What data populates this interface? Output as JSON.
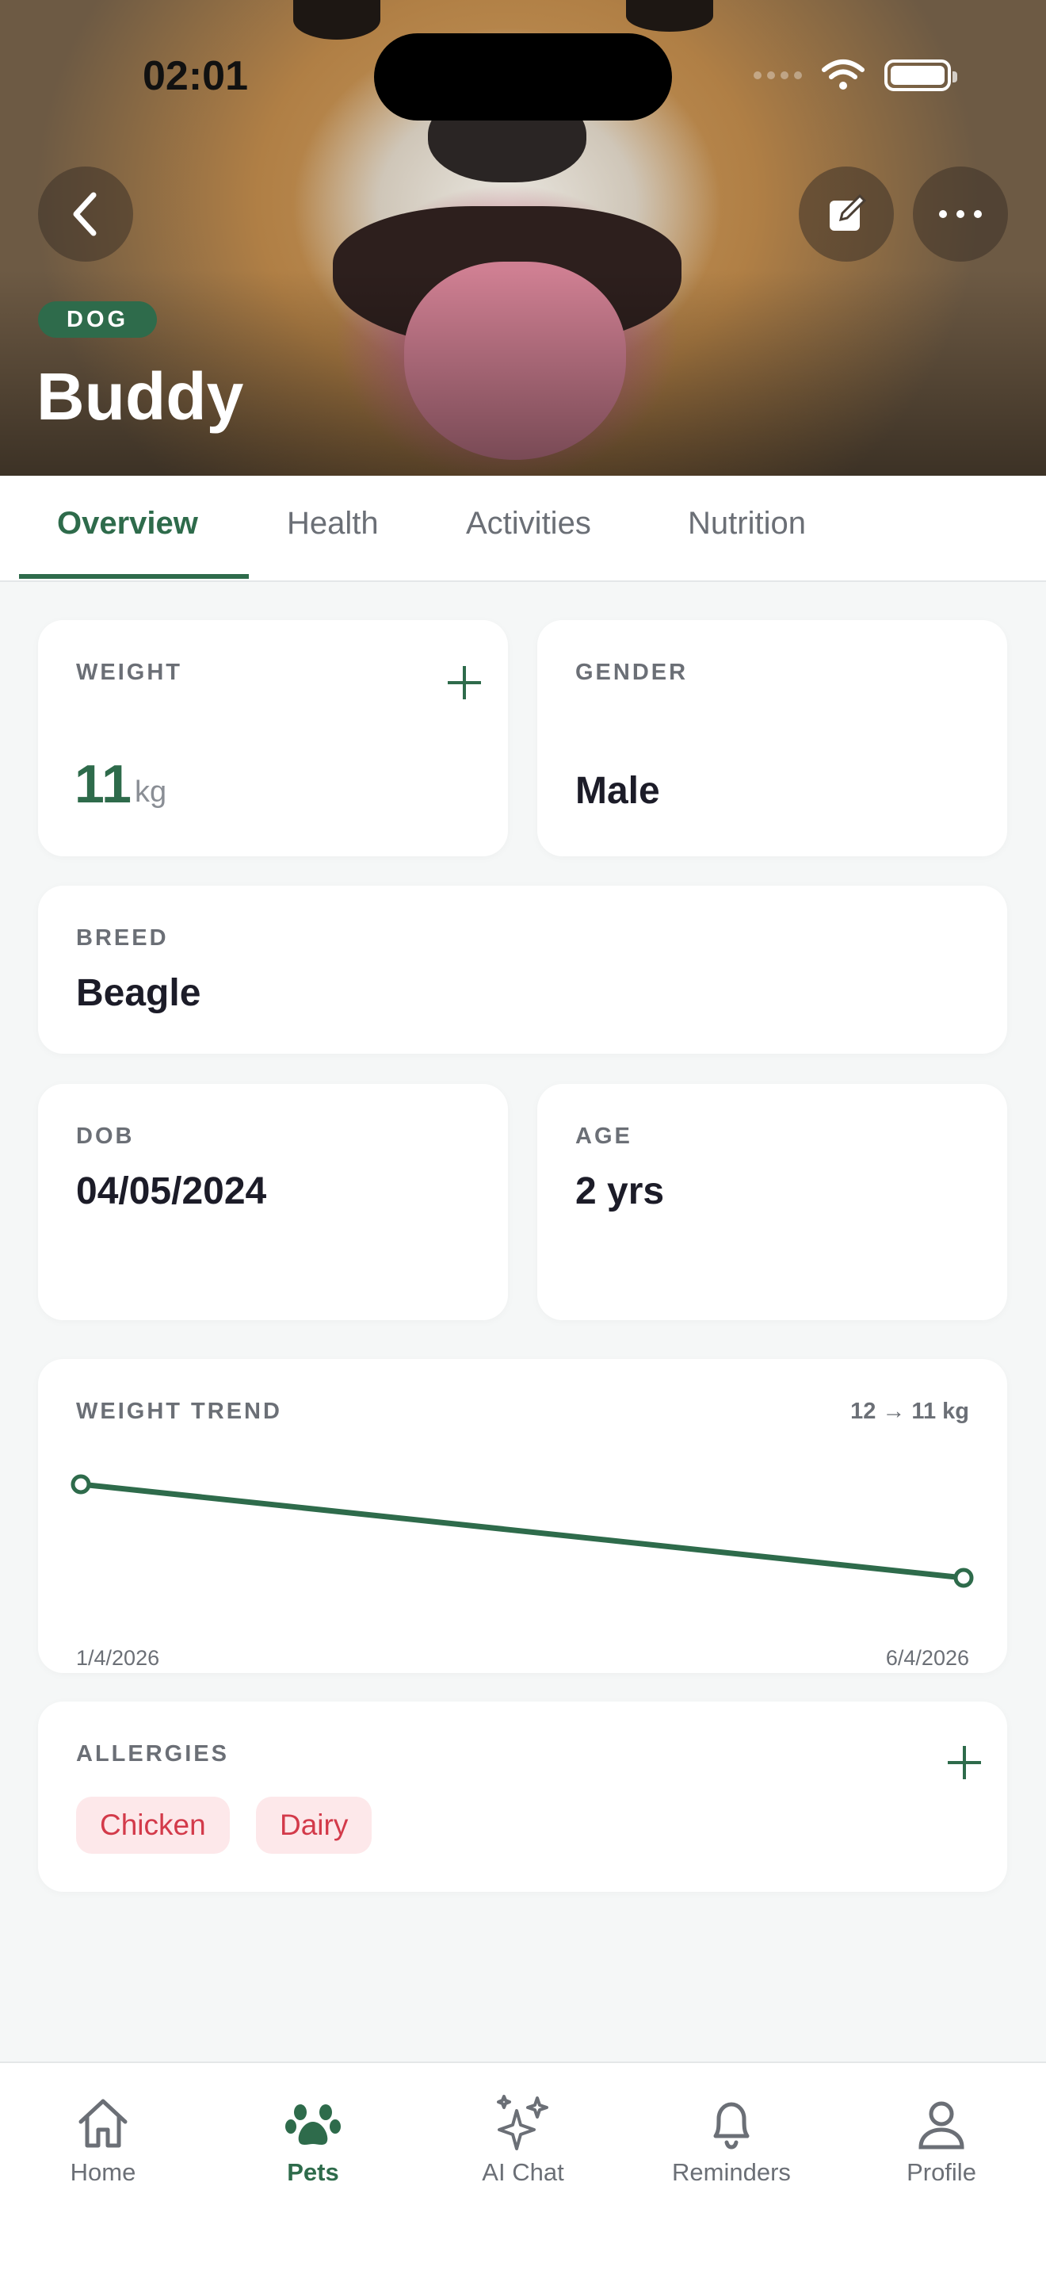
{
  "status_bar": {
    "time": "02:01"
  },
  "pet": {
    "species": "DOG",
    "name": "Buddy"
  },
  "tabs": [
    {
      "label": "Overview",
      "active": true
    },
    {
      "label": "Health",
      "active": false
    },
    {
      "label": "Activities",
      "active": false
    },
    {
      "label": "Nutrition",
      "active": false
    }
  ],
  "weight": {
    "label": "WEIGHT",
    "value": "11",
    "unit": "kg"
  },
  "gender": {
    "label": "GENDER",
    "value": "Male"
  },
  "breed": {
    "label": "BREED",
    "value": "Beagle"
  },
  "dob": {
    "label": "DOB",
    "value": "04/05/2024"
  },
  "age": {
    "label": "AGE",
    "value": "2 yrs"
  },
  "weight_trend": {
    "label": "WEIGHT TREND",
    "range": "12 → 11 kg",
    "start_date": "1/4/2026",
    "end_date": "6/4/2026",
    "points": [
      12,
      11
    ]
  },
  "allergies": {
    "label": "ALLERGIES",
    "items": [
      "Chicken",
      "Dairy"
    ]
  },
  "colors": {
    "accent": "#2e6b4b",
    "danger": "#d33a4a",
    "danger_bg": "#fde8ea"
  },
  "bottom_nav": [
    {
      "label": "Home",
      "icon": "home-icon",
      "active": false
    },
    {
      "label": "Pets",
      "icon": "paw-icon",
      "active": true
    },
    {
      "label": "AI Chat",
      "icon": "sparkles-icon",
      "active": false
    },
    {
      "label": "Reminders",
      "icon": "bell-icon",
      "active": false
    },
    {
      "label": "Profile",
      "icon": "person-icon",
      "active": false
    }
  ]
}
